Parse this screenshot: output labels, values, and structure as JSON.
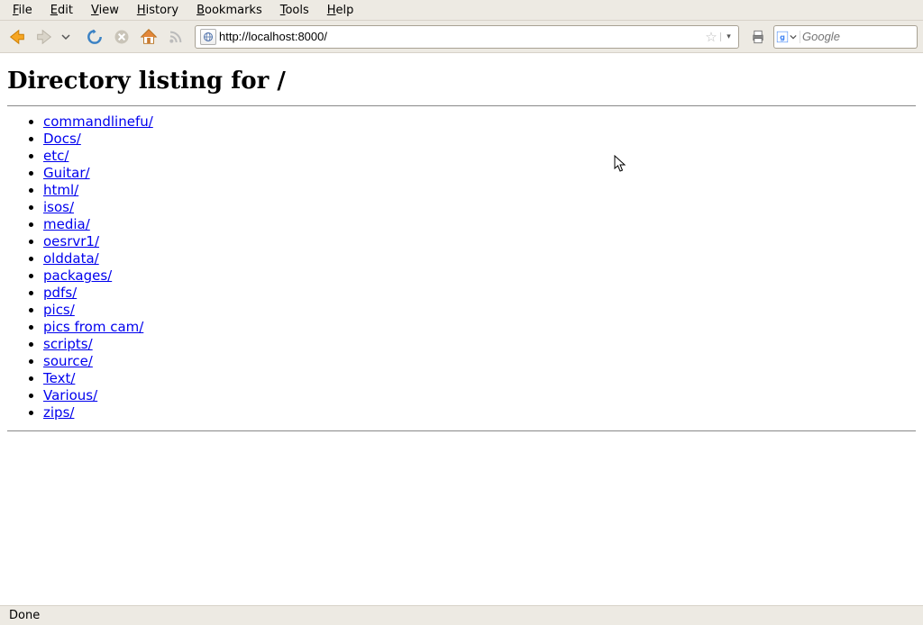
{
  "menubar": {
    "items": [
      "File",
      "Edit",
      "View",
      "History",
      "Bookmarks",
      "Tools",
      "Help"
    ]
  },
  "toolbar": {
    "back_tip": "Back",
    "forward_tip": "Forward",
    "reload_tip": "Reload",
    "stop_tip": "Stop",
    "home_tip": "Home"
  },
  "address": {
    "url": "http://localhost:8000/"
  },
  "search": {
    "placeholder": "Google"
  },
  "page": {
    "title": "Directory listing for /",
    "links": [
      "commandlinefu/",
      "Docs/",
      "etc/",
      "Guitar/",
      "html/",
      "isos/",
      "media/",
      "oesrvr1/",
      "olddata/",
      "packages/",
      "pdfs/",
      "pics/",
      "pics from cam/",
      "scripts/",
      "source/",
      "Text/",
      "Various/",
      "zips/"
    ]
  },
  "status": {
    "text": "Done"
  }
}
